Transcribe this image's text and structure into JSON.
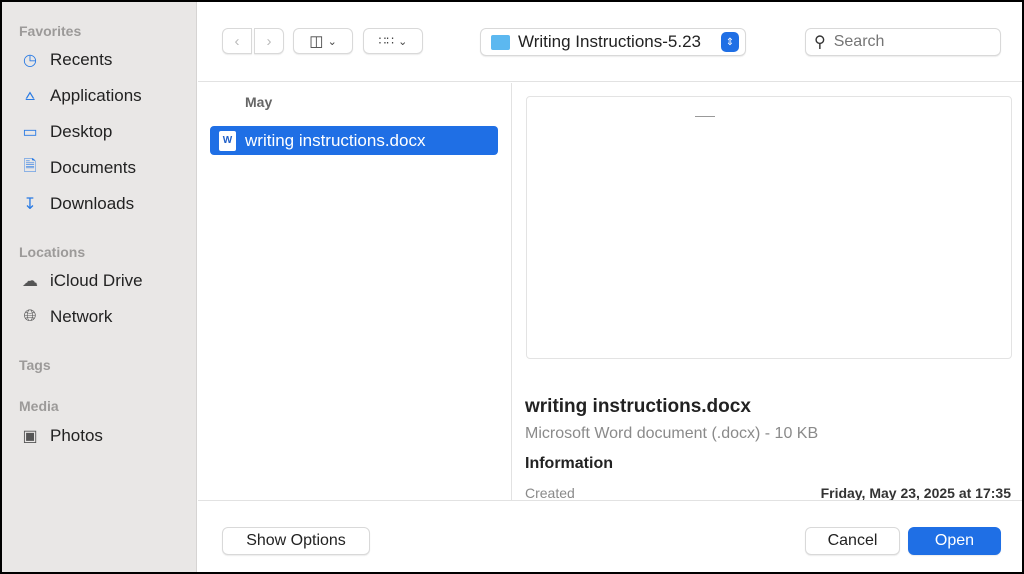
{
  "sidebar": {
    "favorites_label": "Favorites",
    "favorites": [
      {
        "label": "Recents",
        "icon": "clock-icon"
      },
      {
        "label": "Applications",
        "icon": "applications-icon"
      },
      {
        "label": "Desktop",
        "icon": "desktop-icon"
      },
      {
        "label": "Documents",
        "icon": "document-icon"
      },
      {
        "label": "Downloads",
        "icon": "download-icon"
      }
    ],
    "locations_label": "Locations",
    "locations": [
      {
        "label": "iCloud Drive",
        "icon": "cloud-icon"
      },
      {
        "label": "Network",
        "icon": "globe-icon"
      }
    ],
    "tags_label": "Tags",
    "media_label": "Media",
    "media": [
      {
        "label": "Photos",
        "icon": "camera-icon"
      }
    ]
  },
  "toolbar": {
    "folder": "Writing Instructions-5.23",
    "search_placeholder": "Search"
  },
  "file_list": {
    "group": "May",
    "files": [
      {
        "name": "writing instructions.docx",
        "selected": true
      }
    ]
  },
  "preview": {
    "name": "writing instructions.docx",
    "kind": "Microsoft Word document (.docx) - 10 KB",
    "info_heading": "Information",
    "created_label": "Created",
    "created_value": "Friday, May 23, 2025 at 17:35"
  },
  "footer": {
    "show_options": "Show Options",
    "cancel": "Cancel",
    "open": "Open"
  },
  "colors": {
    "accent": "#1f6fe5"
  }
}
